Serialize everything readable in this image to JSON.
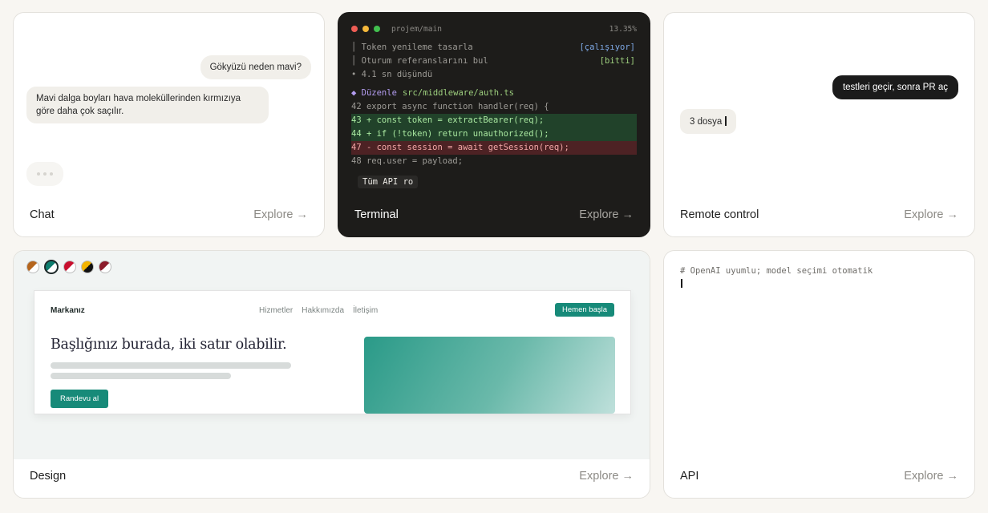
{
  "explore_label": "Explore →",
  "chat": {
    "title": "Chat",
    "user_message": "Gökyüzü neden mavi?",
    "bot_message": "Mavi dalga boyları hava moleküllerinden kırmızıya göre daha çok saçılır."
  },
  "terminal": {
    "title": "Terminal",
    "path": "projem/main",
    "percent": "13.35%",
    "window_colors": [
      "#ee5d55",
      "#f5b83b",
      "#42c04f"
    ],
    "tasks": [
      {
        "text": "│ Token yenileme tasarla",
        "status": "[çalışıyor]",
        "status_color": "#7ea9e6"
      },
      {
        "text": "│ Oturum referanslarını bul",
        "status": "[bitti]",
        "status_color": "#9dcf7e"
      }
    ],
    "thought": "• 4.1 sn düşündü",
    "edit_prefix": "◆ Düzenle",
    "edit_file": "src/middleware/auth.ts",
    "diff": [
      {
        "text": "42 export async function handler(req) {",
        "kind": "ctx"
      },
      {
        "text": "43 + const token = extractBearer(req);",
        "kind": "add"
      },
      {
        "text": "44 + if (!token) return unauthorized();",
        "kind": "add"
      },
      {
        "text": "47 - const session = await getSession(req);",
        "kind": "del"
      },
      {
        "text": "48 req.user = payload;",
        "kind": "ctx"
      }
    ],
    "tag": "Tüm API ro"
  },
  "remote": {
    "title": "Remote control",
    "user_message": "testleri geçir, sonra PR aç",
    "input_value": "3 dosya"
  },
  "design": {
    "title": "Design",
    "swatches": [
      {
        "a": "#b5651d",
        "b": "#ffffff",
        "active": false
      },
      {
        "a": "#0e7d6e",
        "b": "#ffffff",
        "active": true
      },
      {
        "a": "#c8102e",
        "b": "#ffffff",
        "active": false
      },
      {
        "a": "#f4b400",
        "b": "#111111",
        "active": false
      },
      {
        "a": "#8c1c2c",
        "b": "#ffffff",
        "active": false
      }
    ],
    "site": {
      "brand": "Markanız",
      "nav": [
        "Hizmetler",
        "Hakkımızda",
        "İletişim"
      ],
      "cta": "Hemen başla",
      "headline": "Başlığınız burada, iki satır olabilir.",
      "button": "Randevu al"
    }
  },
  "api": {
    "title": "API",
    "comment": "# OpenAI uyumlu; model seçimi otomatik"
  }
}
